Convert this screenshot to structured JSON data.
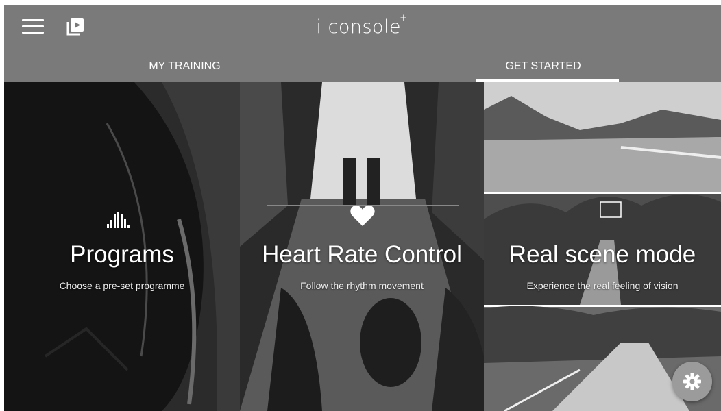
{
  "header": {
    "app_name": "i console",
    "app_name_suffix": "+",
    "menu_icon": "menu-icon",
    "video_icon": "video-library-icon"
  },
  "tabs": [
    {
      "label": "MY TRAINING",
      "active": false
    },
    {
      "label": "GET STARTED",
      "active": true
    }
  ],
  "cards": [
    {
      "icon": "bar-chart-icon",
      "title": "Programs",
      "subtitle": "Choose a pre-set programme"
    },
    {
      "icon": "heart-icon",
      "title": "Heart Rate Control",
      "subtitle": "Follow the rhythm movement"
    },
    {
      "icon": "play-icon",
      "title": "Real scene mode",
      "subtitle": "Experience the real feeling of vision"
    }
  ],
  "fab": {
    "icon": "gear-icon"
  },
  "colors": {
    "bar": "#7a7a7a",
    "text": "#ffffff",
    "fab": "#9b9b9b"
  }
}
